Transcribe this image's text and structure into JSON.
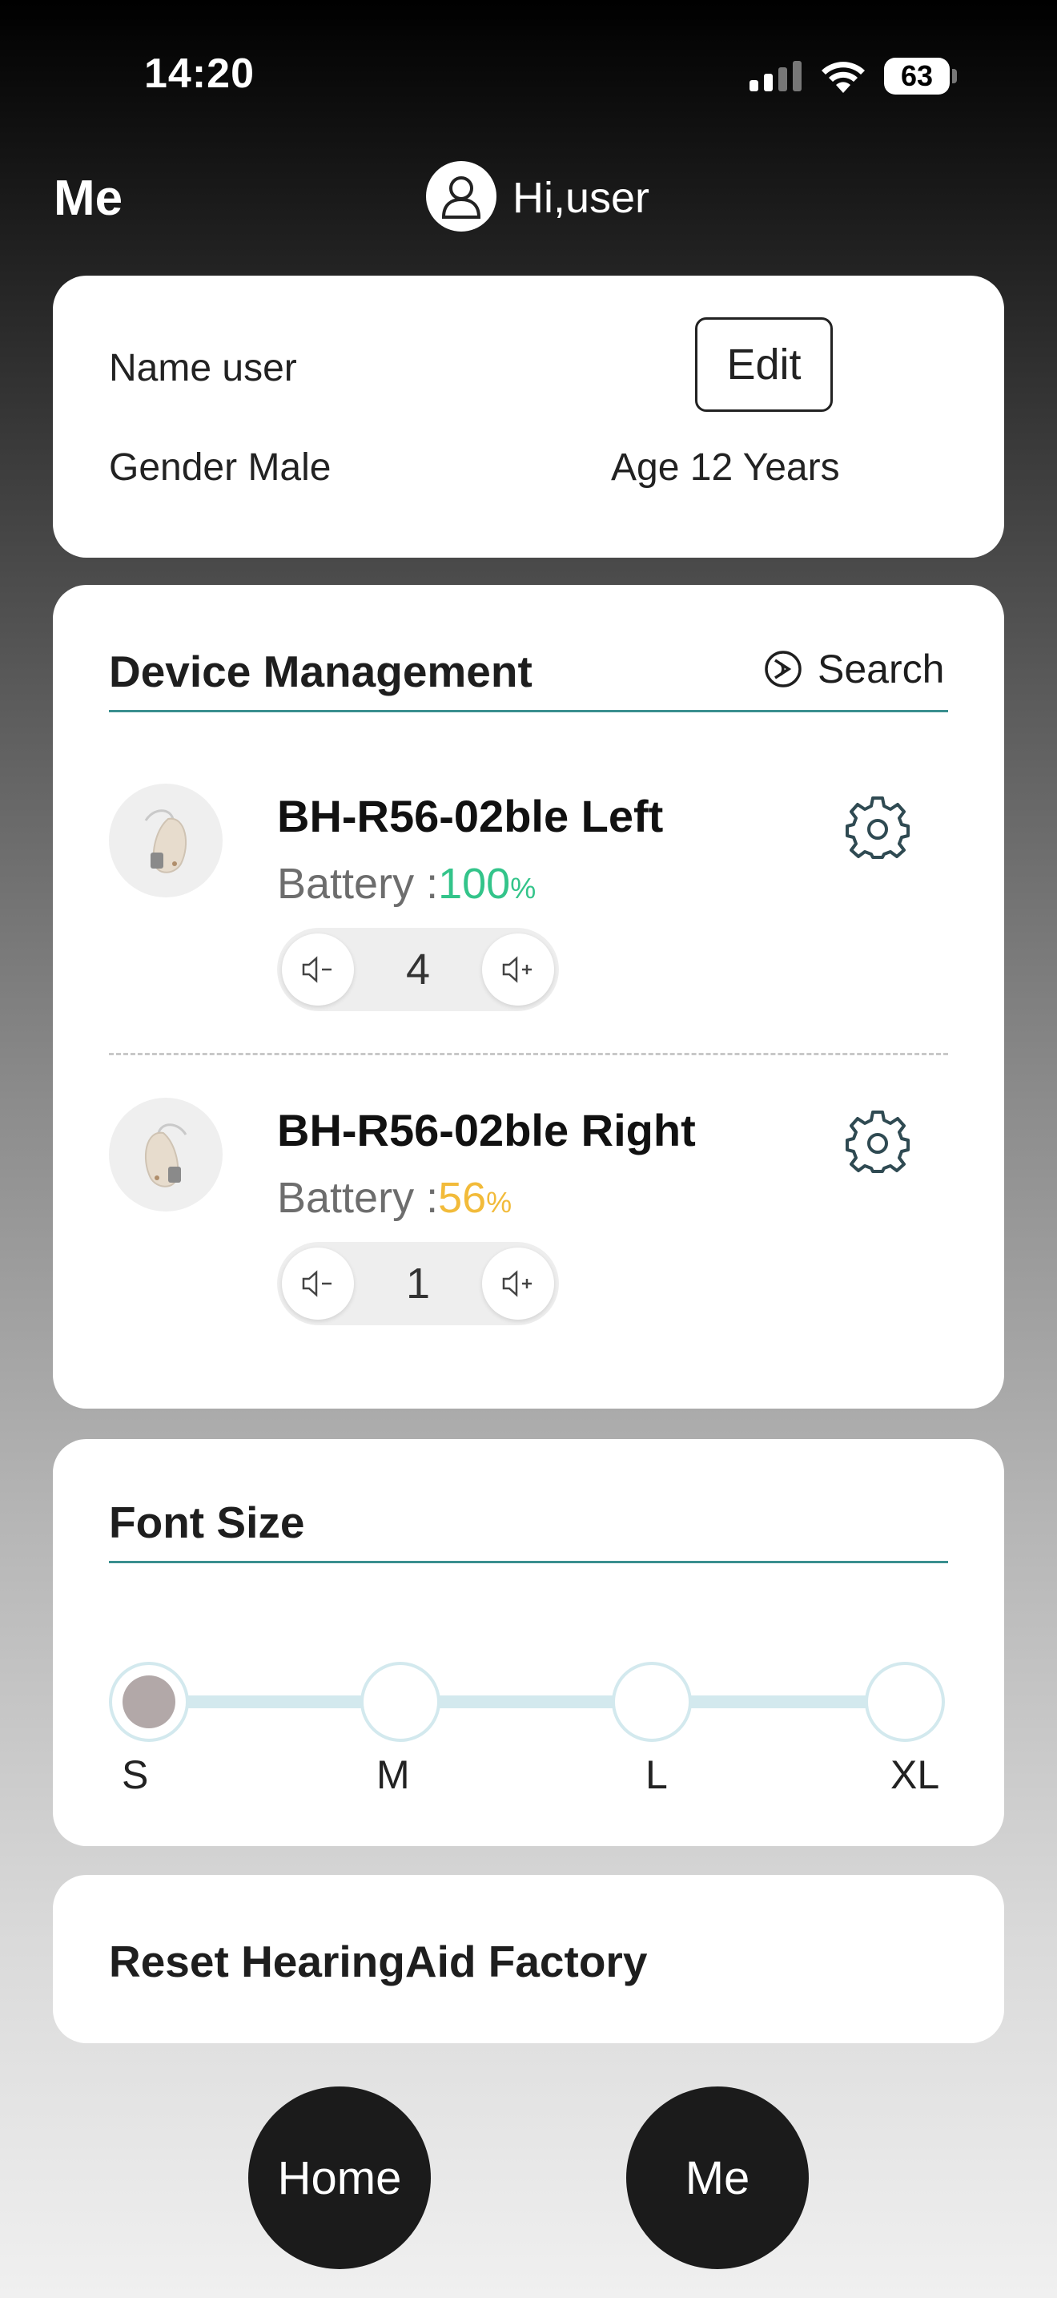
{
  "status_bar": {
    "time": "14:20",
    "battery_level": "63"
  },
  "header": {
    "title": "Me",
    "greeting": "Hi,user"
  },
  "profile": {
    "name": "Name user",
    "gender": "Gender Male",
    "age": "Age 12 Years",
    "edit_label": "Edit"
  },
  "device_management": {
    "title": "Device Management",
    "search_label": "Search",
    "battery_prefix": "Battery :",
    "devices": [
      {
        "name": "BH-R56-02ble Left",
        "battery": "100",
        "battery_color": "#33c48a",
        "volume": "4"
      },
      {
        "name": "BH-R56-02ble Right",
        "battery": "56",
        "battery_color": "#f2bb3a",
        "volume": "1"
      }
    ],
    "percent_sign": "%"
  },
  "font_size": {
    "title": "Font Size",
    "options": [
      "S",
      "M",
      "L",
      "XL"
    ],
    "selected": "S"
  },
  "reset": {
    "label": "Reset HearingAid Factory"
  },
  "nav": {
    "home_label": "Home",
    "me_label": "Me"
  },
  "colors": {
    "accent_line": "#3a8f8f",
    "slider_track": "#d3e9ee",
    "nav_button": "#1b1b1b"
  }
}
